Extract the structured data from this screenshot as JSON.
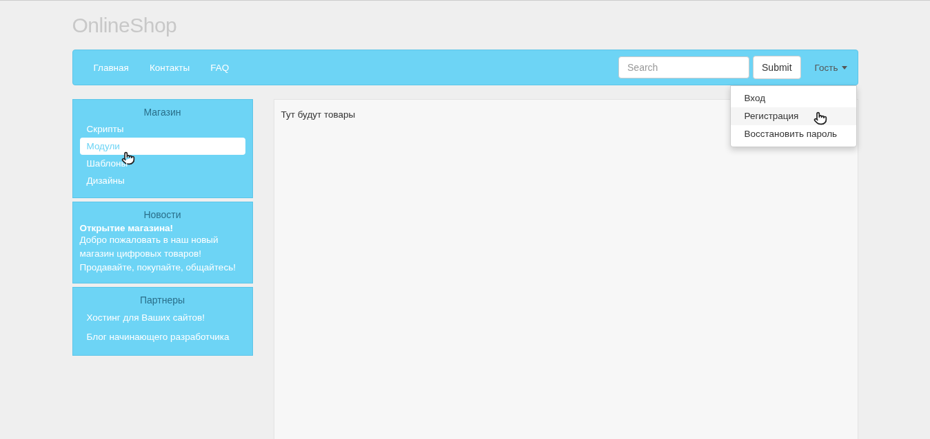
{
  "brand": "OnlineShop",
  "navbar": {
    "links": [
      {
        "label": "Главная"
      },
      {
        "label": "Контакты"
      },
      {
        "label": "FAQ"
      }
    ],
    "search": {
      "placeholder": "Search"
    },
    "submit": "Submit",
    "user_menu": {
      "label": "Гость",
      "expanded": true,
      "items": [
        {
          "label": "Вход",
          "selected": false
        },
        {
          "label": "Регистрация",
          "selected": true
        },
        {
          "label": "Восстановить пароль",
          "selected": false
        }
      ]
    }
  },
  "sidebar": {
    "shop": {
      "title": "Магазин",
      "items": [
        {
          "label": "Скрипты",
          "selected": false
        },
        {
          "label": "Модули",
          "selected": true
        },
        {
          "label": "Шаблоны",
          "selected": false
        },
        {
          "label": "Дизайны",
          "selected": false
        }
      ]
    },
    "news": {
      "title": "Новости",
      "headline": "Открытие магазина!",
      "text": "Добро пожаловать в наш новый магазин цифровых товаров! Продавайте, покупайте, общайтесь!"
    },
    "partners": {
      "title": "Партнеры",
      "links": [
        {
          "label": "Хостинг для Ваших сайтов!"
        },
        {
          "label": "Блог начинающего разработчика"
        }
      ]
    }
  },
  "content": {
    "text": "Тут будут товары"
  }
}
